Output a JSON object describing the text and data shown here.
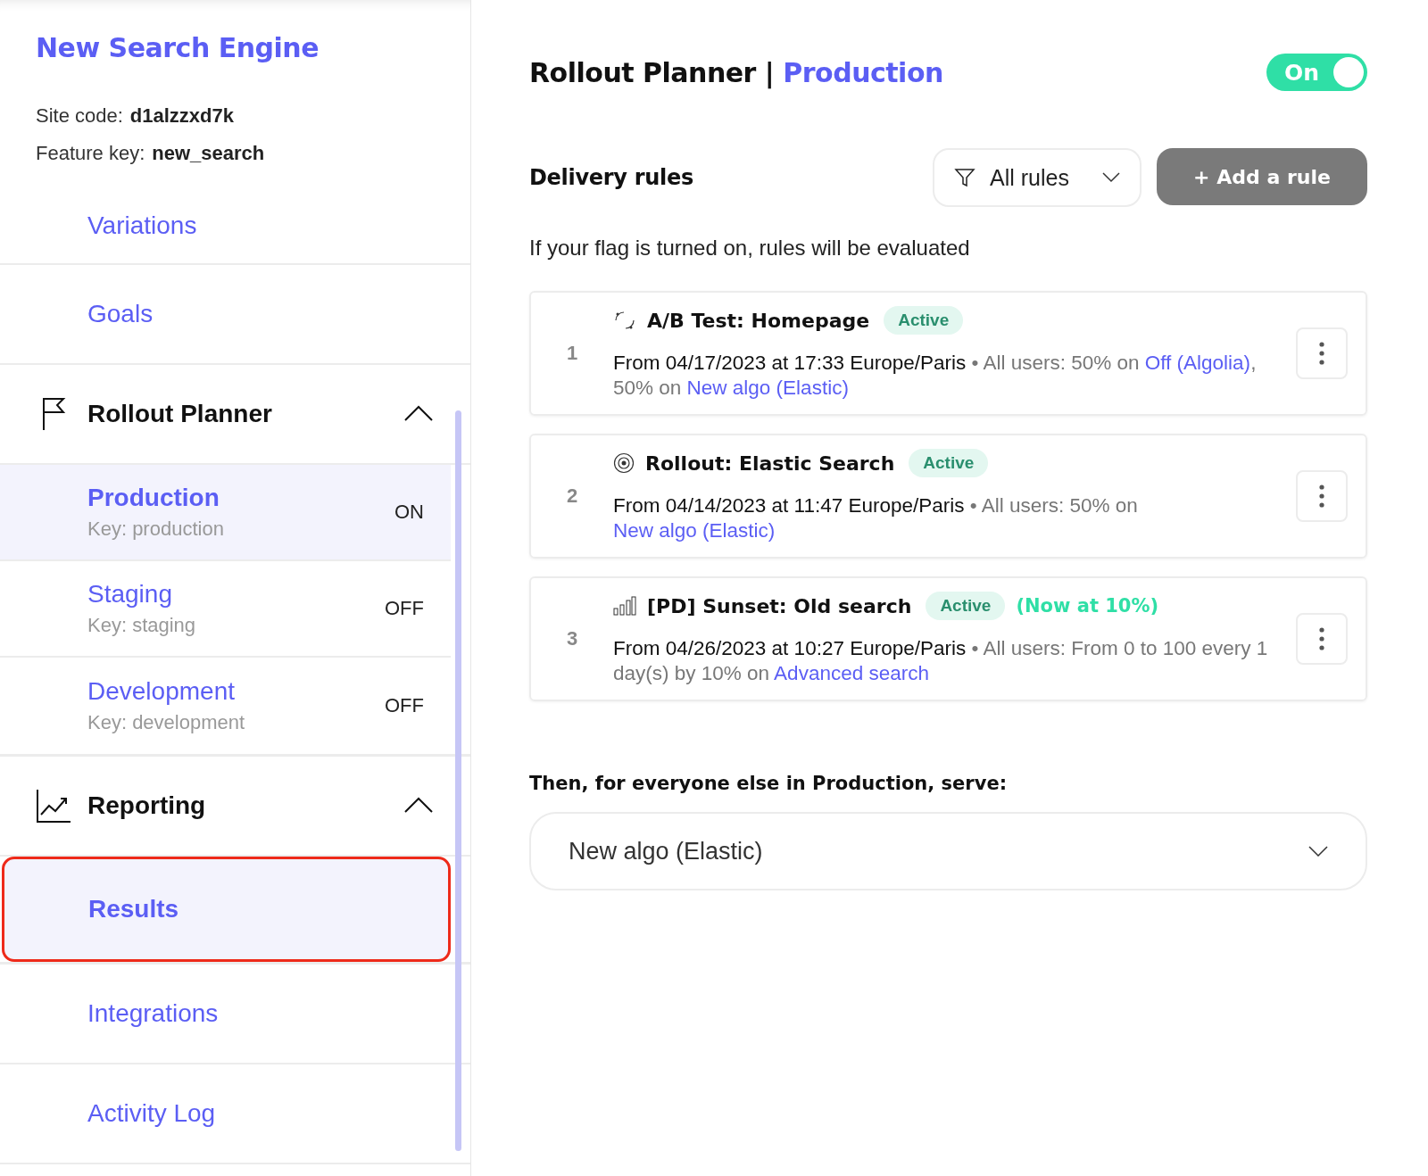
{
  "sidebar": {
    "title": "New Search Engine",
    "site_code": {
      "label": "Site code:",
      "value": "d1alzzxd7k"
    },
    "feature_key": {
      "label": "Feature key:",
      "value": "new_search"
    },
    "items": [
      {
        "kind": "link",
        "label": "Variations"
      },
      {
        "kind": "link",
        "label": "Goals"
      },
      {
        "kind": "planner",
        "label": "Rollout Planner",
        "expanded": true,
        "children": [
          {
            "label": "Production",
            "key": "Key: production",
            "status": "ON",
            "selected": true,
            "highlighted": false
          },
          {
            "label": "Staging",
            "key": "Key: staging",
            "status": "OFF",
            "selected": false,
            "highlighted": false
          },
          {
            "label": "Development",
            "key": "Key: development",
            "status": "OFF",
            "selected": false,
            "highlighted": false
          }
        ]
      },
      {
        "kind": "reporting",
        "label": "Reporting",
        "expanded": true,
        "children": [
          {
            "label": "Results",
            "selected": true,
            "highlighted": true
          }
        ]
      },
      {
        "kind": "link",
        "label": "Integrations"
      },
      {
        "kind": "link",
        "label": "Activity Log"
      }
    ]
  },
  "header": {
    "title": "Rollout Planner |",
    "environment": "Production",
    "toggle": {
      "label": "On",
      "on": true
    }
  },
  "delivery_rules": {
    "title": "Delivery rules",
    "filter": {
      "label": "All rules"
    },
    "add_button": "+ Add a rule",
    "description": "If your flag is turned on, rules will be evaluated",
    "rules": [
      {
        "number": "1",
        "kind": "ab",
        "name": "A/B Test: Homepage",
        "badge": "Active",
        "description": [
          {
            "kind": "date",
            "text": "From 04/17/2023 at 17:33 Europe/Paris"
          },
          {
            "kind": "text",
            "text": " • All users: 50% on "
          },
          {
            "kind": "link",
            "text": "Off (Algolia)"
          },
          {
            "kind": "text",
            "text": ", 50% on "
          },
          {
            "kind": "link",
            "text": "New algo (Elastic)"
          }
        ]
      },
      {
        "number": "2",
        "kind": "rollout",
        "name": "Rollout: Elastic Search",
        "badge": "Active",
        "description": [
          {
            "kind": "date",
            "text": "From 04/14/2023 at 11:47 Europe/Paris"
          },
          {
            "kind": "text",
            "text": " • All users: 50% on "
          },
          {
            "kind": "link",
            "text": "New algo (Elastic)"
          }
        ]
      },
      {
        "number": "3",
        "kind": "progressive",
        "name": "[PD] Sunset: Old search",
        "badge": "Active",
        "note": "(Now at 10%)",
        "description": [
          {
            "kind": "date",
            "text": "From 04/26/2023 at 10:27 Europe/Paris"
          },
          {
            "kind": "text",
            "text": " • All users: From 0 to 100 every 1 day(s) by 10% on "
          },
          {
            "kind": "link",
            "text": "Advanced search"
          }
        ]
      }
    ]
  },
  "fallback": {
    "label": "Then, for everyone else in Production, serve:",
    "value": "New algo (Elastic)"
  }
}
